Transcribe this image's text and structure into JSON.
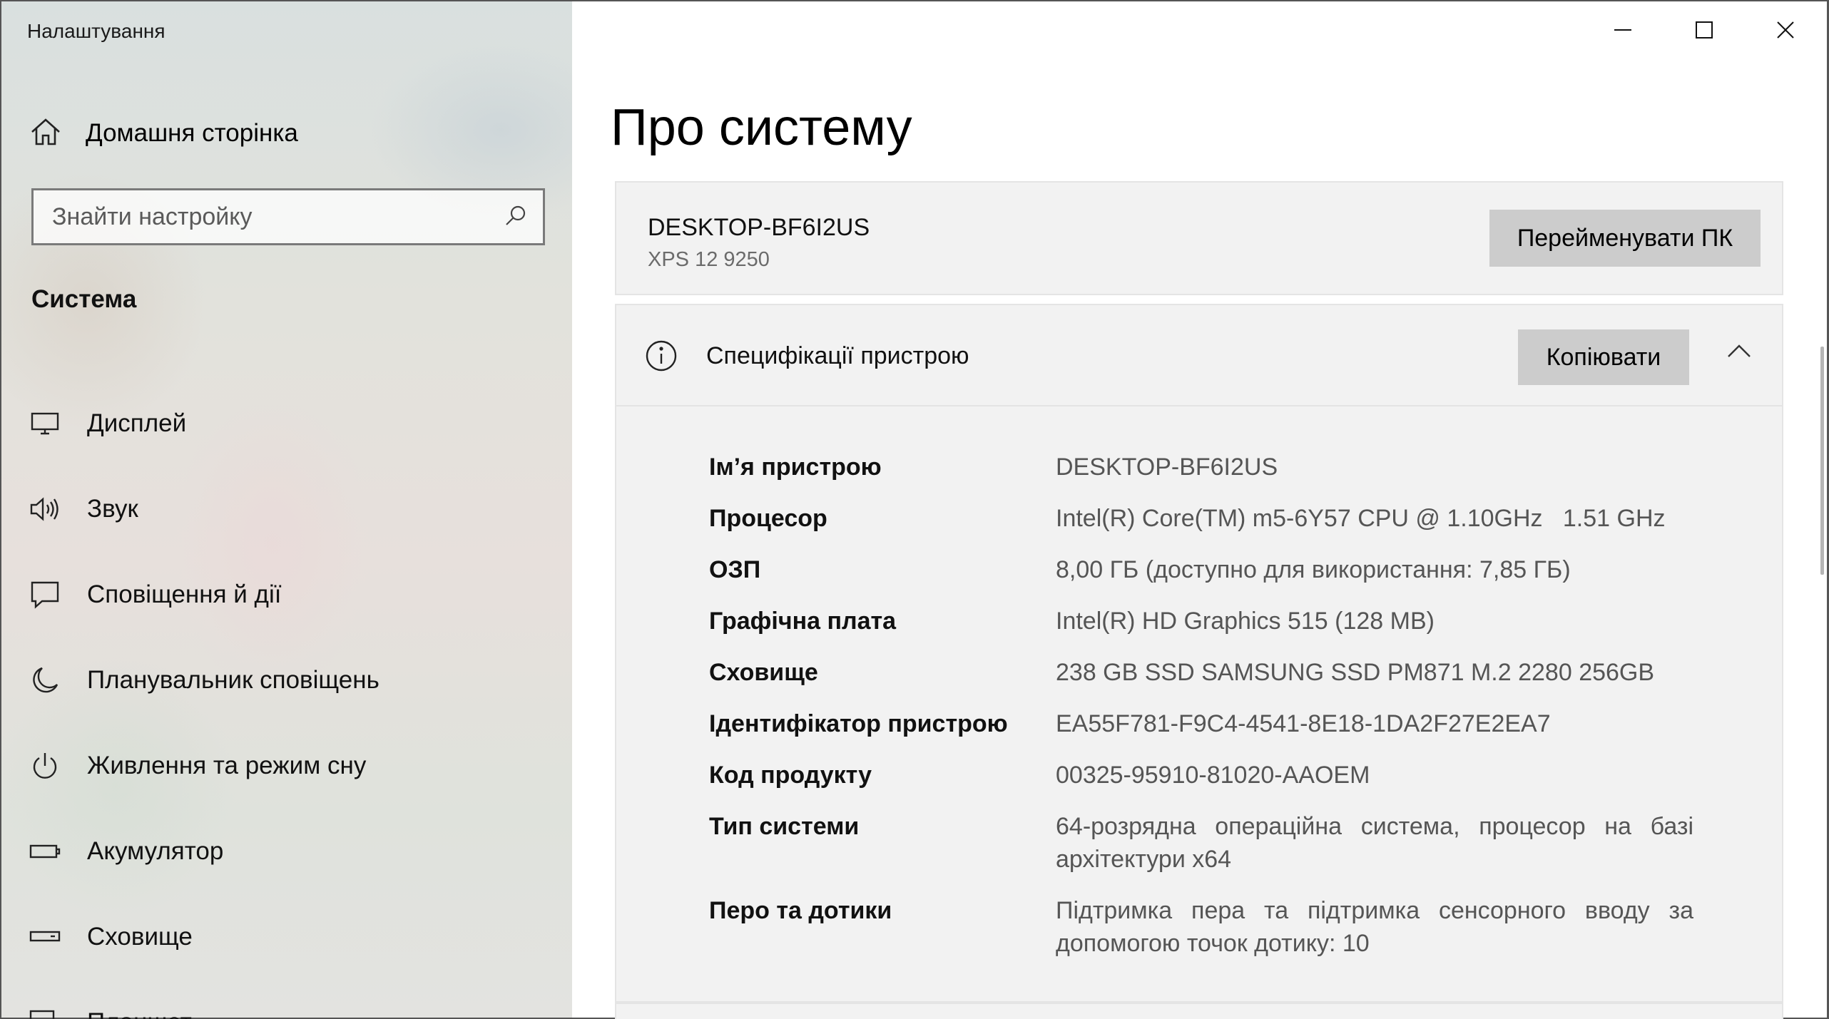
{
  "window": {
    "title": "Налаштування",
    "controls": [
      "minimize",
      "maximize",
      "close"
    ]
  },
  "sidebar": {
    "home_label": "Домашня сторінка",
    "search_placeholder": "Знайти настройку",
    "section_title": "Система",
    "items": [
      {
        "label": "Дисплей",
        "icon": "monitor-icon"
      },
      {
        "label": "Звук",
        "icon": "speaker-icon"
      },
      {
        "label": "Сповіщення й дії",
        "icon": "notification-icon"
      },
      {
        "label": "Планувальник сповіщень",
        "icon": "moon-icon"
      },
      {
        "label": "Живлення та режим сну",
        "icon": "power-icon"
      },
      {
        "label": "Акумулятор",
        "icon": "battery-icon"
      },
      {
        "label": "Сховище",
        "icon": "storage-icon"
      },
      {
        "label": "Планшет",
        "icon": "tablet-icon"
      }
    ]
  },
  "main": {
    "page_title": "Про систему",
    "pc": {
      "name": "DESKTOP-BF6I2US",
      "model": "XPS 12 9250",
      "rename_button": "Перейменувати ПК"
    },
    "specs": {
      "title": "Специфікації пристрою",
      "copy_button": "Копіювати",
      "rows": [
        {
          "key": "Ім’я пристрою",
          "value": "DESKTOP-BF6I2US"
        },
        {
          "key": "Процесор",
          "value": "Intel(R) Core(TM) m5-6Y57 CPU @ 1.10GHz   1.51 GHz"
        },
        {
          "key": "ОЗП",
          "value": "8,00 ГБ (доступно для використання: 7,85 ГБ)"
        },
        {
          "key": "Графічна плата",
          "value": "Intel(R) HD Graphics 515 (128 MB)"
        },
        {
          "key": "Сховище",
          "value": "238 GB SSD SAMSUNG SSD PM871 M.2 2280 256GB"
        },
        {
          "key": "Ідентифікатор пристрою",
          "value": "EA55F781-F9C4-4541-8E18-1DA2F27E2EA7"
        },
        {
          "key": "Код продукту",
          "value": "00325-95910-81020-AAOEM"
        },
        {
          "key": "Тип системи",
          "value": "64-розрядна операційна система, процесор на базі архітектури x64"
        },
        {
          "key": "Перо та дотики",
          "value": "Підтримка пера та підтримка сенсорного вводу за допомогою точок дотику: 10"
        }
      ]
    }
  }
}
